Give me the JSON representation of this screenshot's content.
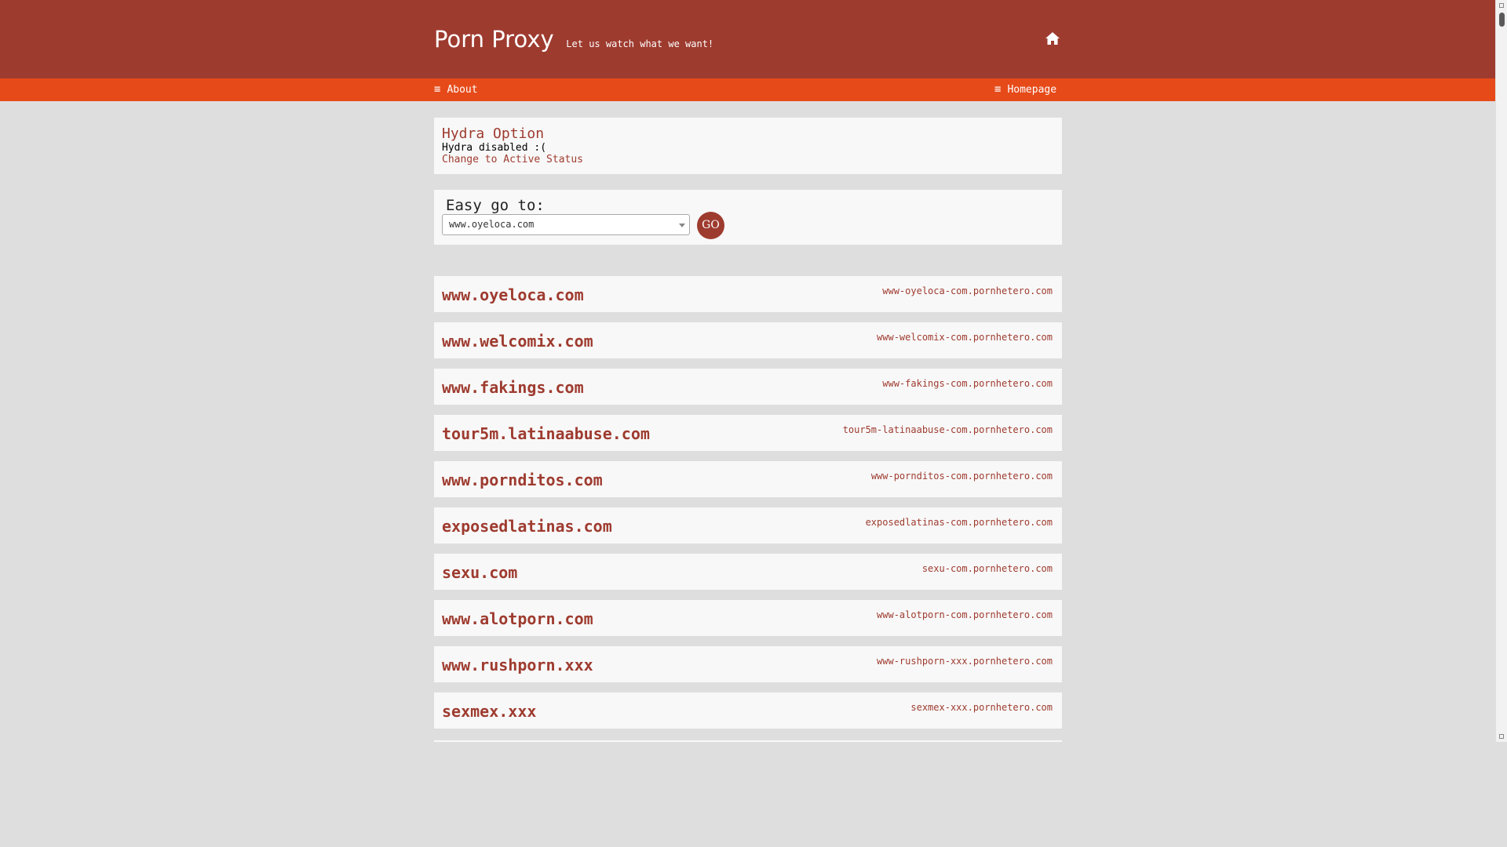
{
  "header": {
    "title": "Porn Proxy",
    "tagline": "Let us watch what we want!"
  },
  "nav": {
    "about": "About",
    "homepage": "Homepage"
  },
  "hydra": {
    "title": "Hydra Option",
    "status": "Hydra disabled :(",
    "link": "Change to Active Status"
  },
  "easy_go": {
    "label": "Easy go to:",
    "selected": "www.oyeloca.com",
    "go_label": "GO"
  },
  "sites": [
    {
      "name": "www.oyeloca.com",
      "proxy": "www-oyeloca-com.pornhetero.com"
    },
    {
      "name": "www.welcomix.com",
      "proxy": "www-welcomix-com.pornhetero.com"
    },
    {
      "name": "www.fakings.com",
      "proxy": "www-fakings-com.pornhetero.com"
    },
    {
      "name": "tour5m.latinaabuse.com",
      "proxy": "tour5m-latinaabuse-com.pornhetero.com"
    },
    {
      "name": "www.pornditos.com",
      "proxy": "www-pornditos-com.pornhetero.com"
    },
    {
      "name": "exposedlatinas.com",
      "proxy": "exposedlatinas-com.pornhetero.com"
    },
    {
      "name": "sexu.com",
      "proxy": "sexu-com.pornhetero.com"
    },
    {
      "name": "www.alotporn.com",
      "proxy": "www-alotporn-com.pornhetero.com"
    },
    {
      "name": "www.rushporn.xxx",
      "proxy": "www-rushporn-xxx.pornhetero.com"
    },
    {
      "name": "sexmex.xxx",
      "proxy": "sexmex-xxx.pornhetero.com"
    }
  ],
  "colors": {
    "header_bg": "#9e3b2f",
    "nav_bg": "#e64a19",
    "accent": "#9e3b2f",
    "page_bg": "#dedede"
  },
  "icons": {
    "home": "home-icon",
    "menu": "hamburger-icon",
    "dropdown": "chevron-down-icon"
  }
}
